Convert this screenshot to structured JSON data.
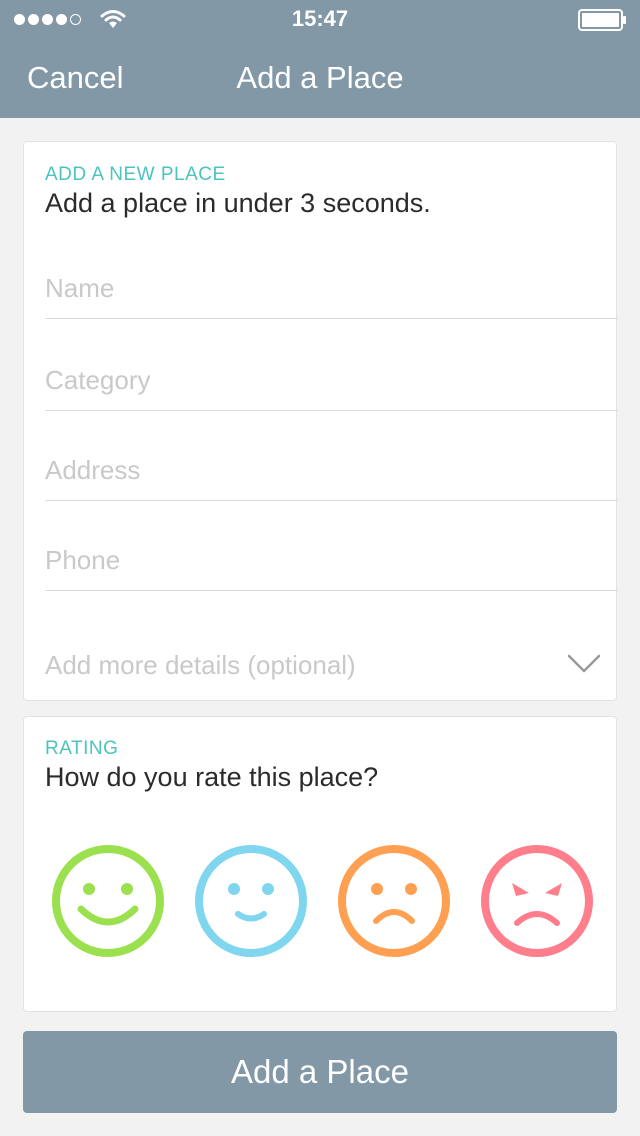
{
  "status_bar": {
    "time": "15:47",
    "signal_icon": "signal-dots-icon",
    "wifi_icon": "wifi-icon",
    "battery_icon": "battery-icon"
  },
  "nav": {
    "cancel_label": "Cancel",
    "title": "Add a Place"
  },
  "form_card": {
    "kicker": "ADD A NEW PLACE",
    "headline": "Add a place in under 3 seconds.",
    "fields": [
      {
        "placeholder": "Name",
        "value": ""
      },
      {
        "placeholder": "Category",
        "value": ""
      },
      {
        "placeholder": "Address",
        "value": ""
      },
      {
        "placeholder": "Phone",
        "value": ""
      }
    ],
    "more_details_label": "Add more details (optional)",
    "more_details_icon": "chevron-down-icon"
  },
  "rating_card": {
    "kicker": "RATING",
    "question": "How do you rate this place?",
    "faces": [
      {
        "icon": "very-happy-face-icon",
        "color": "#9be04f"
      },
      {
        "icon": "happy-face-icon",
        "color": "#7fd6ee"
      },
      {
        "icon": "sad-face-icon",
        "color": "#ff9f52"
      },
      {
        "icon": "angry-face-icon",
        "color": "#ff7e8c"
      }
    ]
  },
  "cta": {
    "label": "Add a Place"
  },
  "colors": {
    "nav_background": "#8298a6",
    "accent": "#4cc3bd",
    "page_background": "#f2f2f2"
  }
}
